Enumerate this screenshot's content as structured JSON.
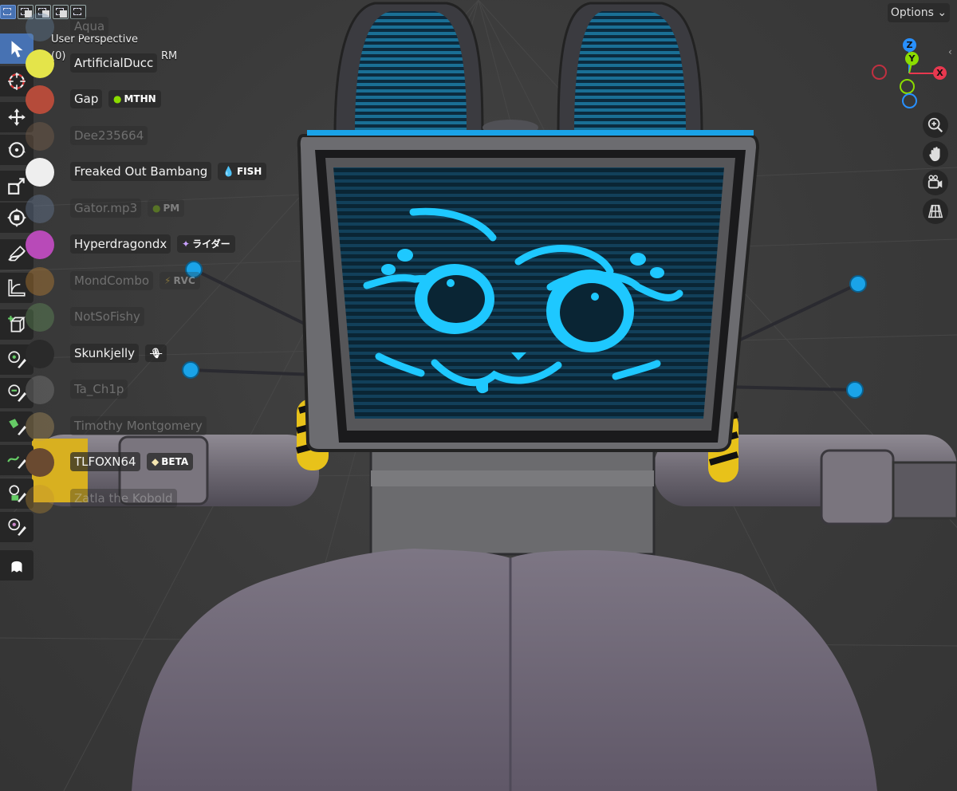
{
  "viewport": {
    "title": "User Perspective",
    "subtitle_prefix": "(0) ",
    "subtitle_suffix": "RM",
    "options_label": "Options"
  },
  "participants": [
    {
      "name": "Aqua",
      "dim": true,
      "badge": "",
      "avatar": "#6a8aa8"
    },
    {
      "name": "ArtificialDucc",
      "dim": false,
      "badge": "",
      "avatar": "#e4e44a"
    },
    {
      "name": "Gap",
      "dim": false,
      "badge": "MTHN",
      "badge_icon": "moon-icon",
      "avatar": "#b54b3a"
    },
    {
      "name": "Dee235664",
      "dim": true,
      "badge": "",
      "avatar": "#8a6a50"
    },
    {
      "name": "Freaked Out Bambang",
      "dim": false,
      "badge": "FISH",
      "badge_icon": "droplet-icon",
      "avatar": "#eeeeee"
    },
    {
      "name": "Gator.mp3",
      "dim": true,
      "badge": "PM",
      "badge_icon": "moon-icon",
      "avatar": "#7088a8"
    },
    {
      "name": "Hyperdragondx",
      "dim": false,
      "badge": "ライダー",
      "badge_icon": "sparkle-icon",
      "avatar": "#b84ab8"
    },
    {
      "name": "MondCombo",
      "dim": true,
      "badge": "RVC",
      "badge_icon": "bolt-icon",
      "avatar": "#d89030"
    },
    {
      "name": "NotSoFishy",
      "dim": true,
      "badge": "",
      "avatar": "#6aa060"
    },
    {
      "name": "Skunkjelly",
      "dim": false,
      "badge": "",
      "avatar": "#2a2a2a",
      "muted": true
    },
    {
      "name": "Ta_Ch1p",
      "dim": true,
      "badge": "",
      "avatar": "#8a8a8a"
    },
    {
      "name": "Timothy Montgomery",
      "dim": true,
      "badge": "",
      "avatar": "#c0a060"
    },
    {
      "name": "TLFOXN64",
      "dim": false,
      "badge": "BETA",
      "badge_icon": "gem-icon",
      "avatar": "#6a4a30"
    },
    {
      "name": "Zatla the Kobold",
      "dim": true,
      "badge": "",
      "avatar": "#c09030"
    }
  ],
  "gizmo": {
    "z": "Z",
    "y": "Y",
    "x": "X",
    "colors": {
      "x": "#e8384f",
      "y": "#8bdc00",
      "z": "#2890ff"
    }
  },
  "tools": [
    "select-box-tool",
    "cursor-tool",
    "move-tool",
    "rotate-tool",
    "scale-tool",
    "transform-tool",
    "annotate-tool",
    "measure-tool",
    "add-cube-tool",
    "paint-tool-1",
    "paint-tool-2",
    "paint-tool-3",
    "paint-tool-4",
    "paint-tool-5",
    "paint-tool-6",
    "ghost-tool"
  ]
}
